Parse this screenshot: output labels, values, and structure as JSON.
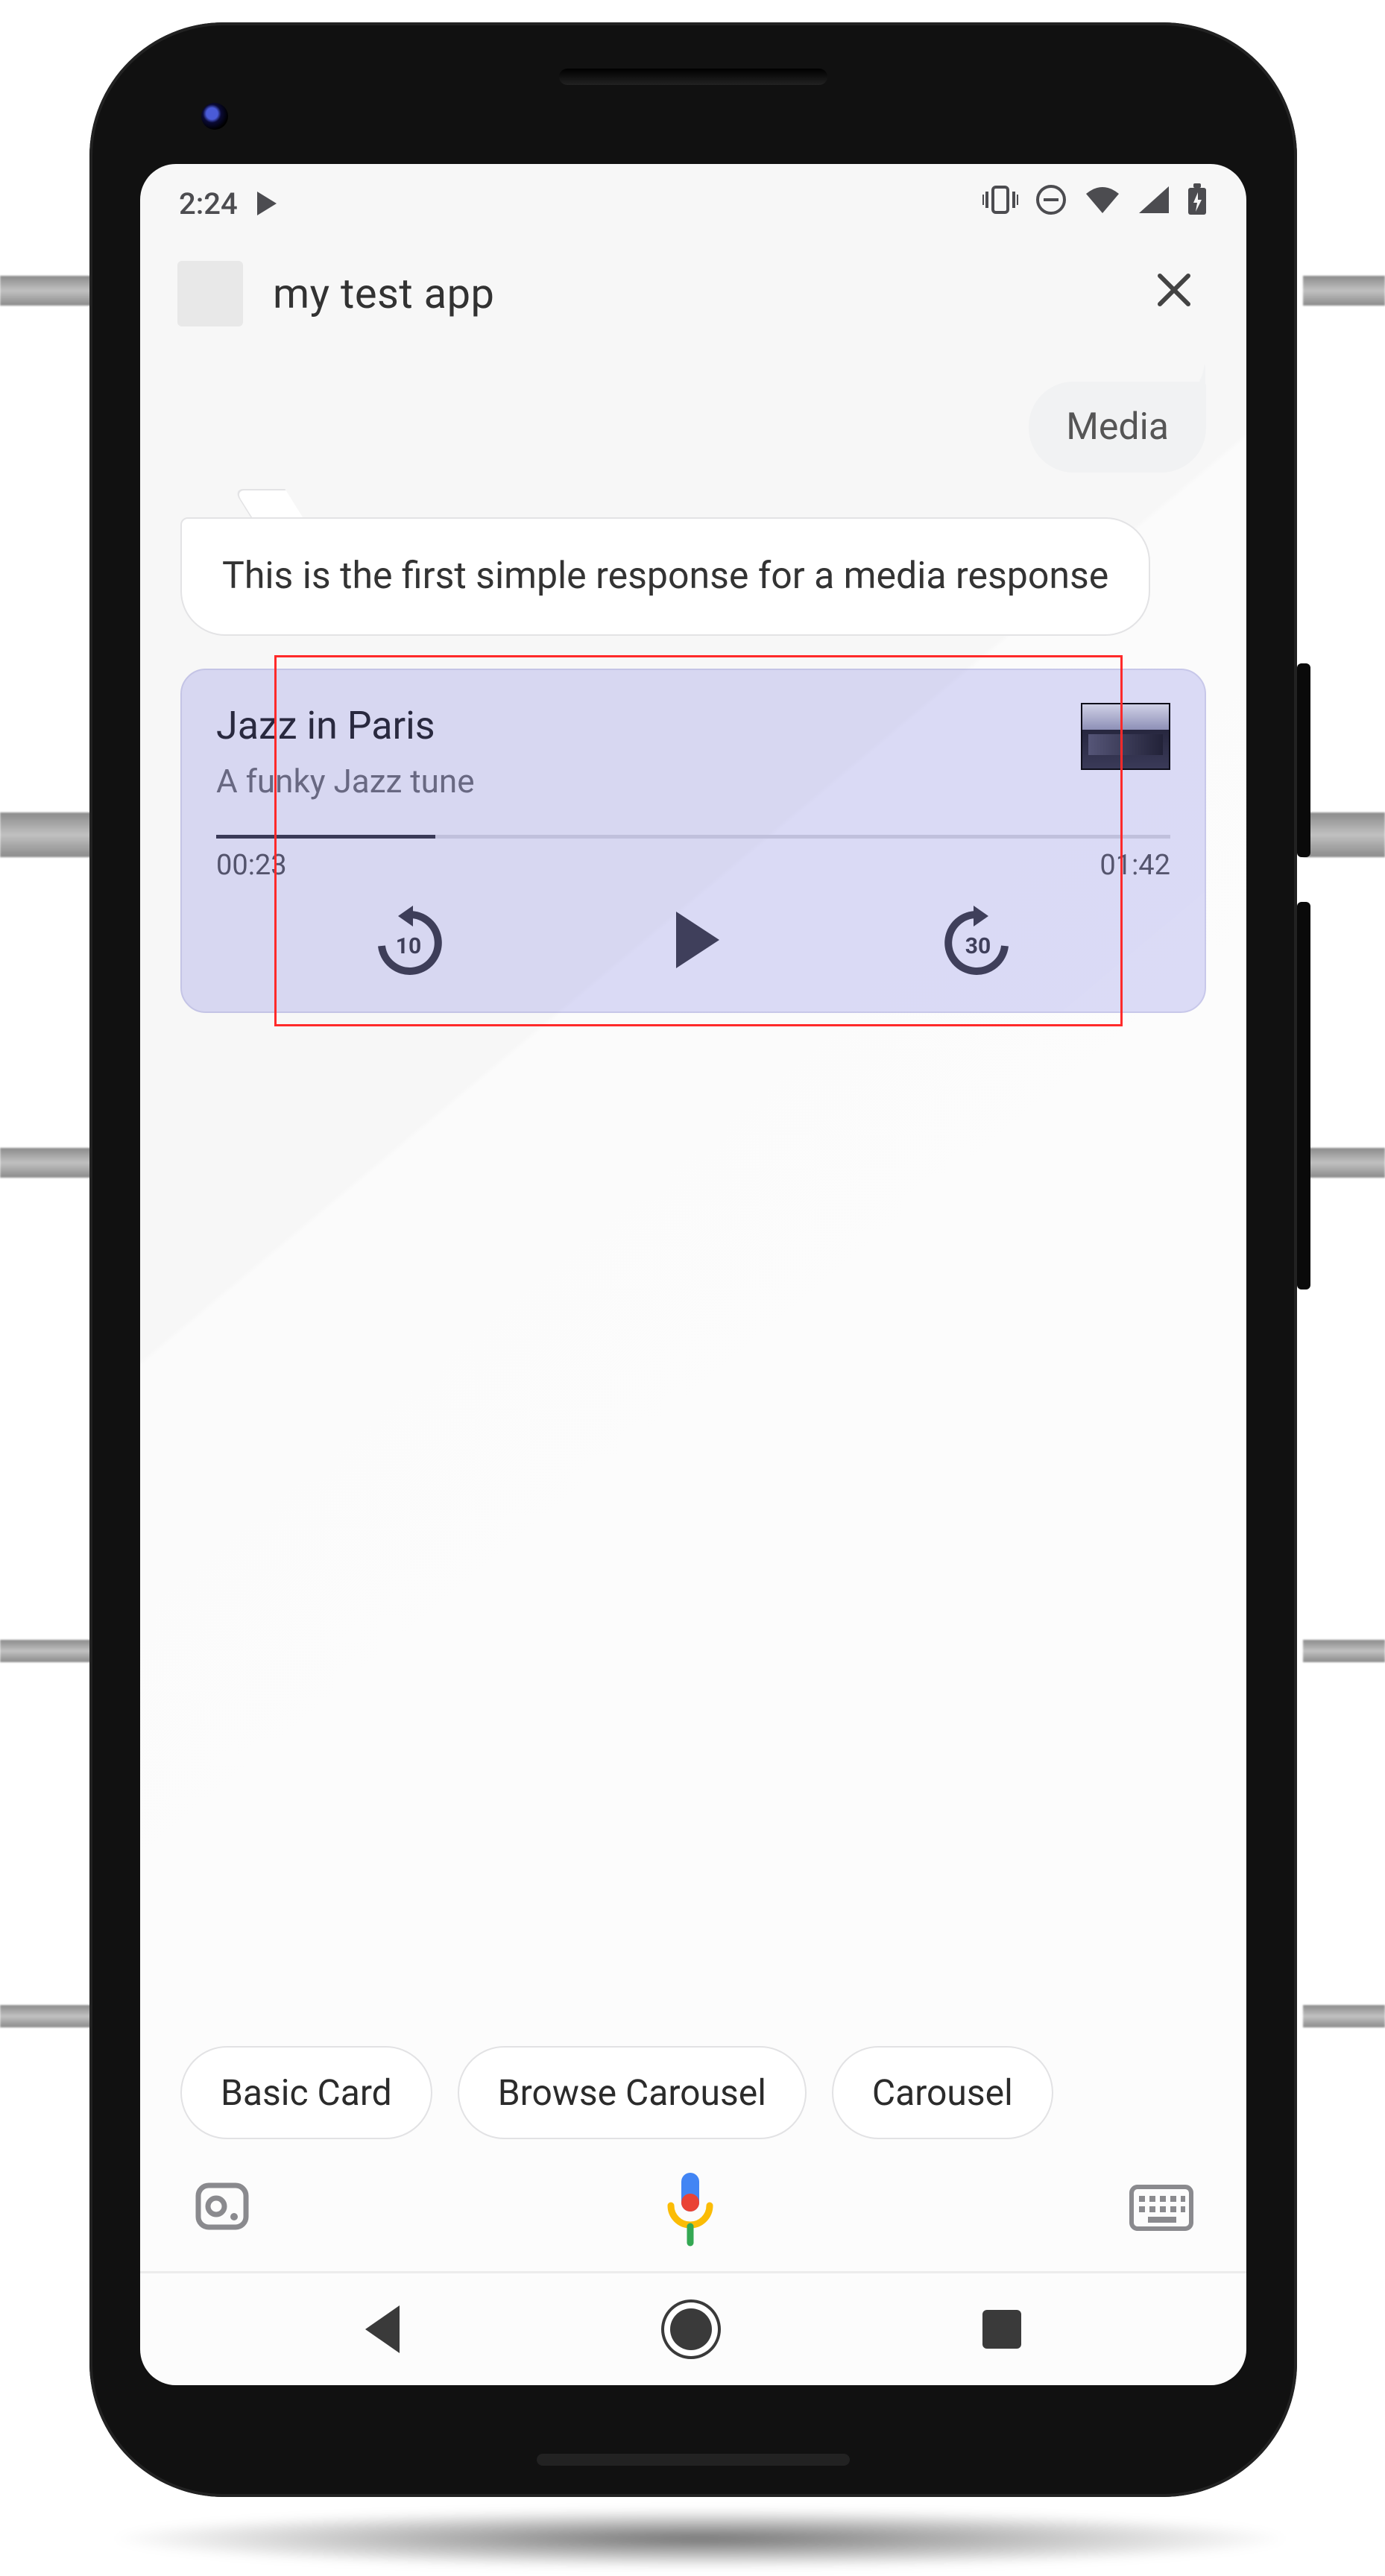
{
  "status": {
    "time": "2:24"
  },
  "header": {
    "app_name": "my test app"
  },
  "conversation": {
    "user_message": "Media",
    "bot_message": "This is the first simple response for a media response"
  },
  "media": {
    "title": "Jazz in Paris",
    "subtitle": "A funky Jazz tune",
    "elapsed": "00:23",
    "duration": "01:42",
    "progress_percent": 23,
    "rewind_seconds": "10",
    "forward_seconds": "30"
  },
  "chips": [
    "Basic Card",
    "Browse Carousel",
    "Carousel"
  ],
  "icons": {
    "playing": "play-icon",
    "vibrate": "vibrate-icon",
    "dnd": "do-not-disturb-icon",
    "wifi": "wifi-icon",
    "cell": "cell-signal-icon",
    "battery": "battery-charging-icon",
    "close": "close-icon",
    "rewind": "rewind-10-icon",
    "play": "play-icon",
    "forward": "forward-30-icon",
    "lens": "lens-icon",
    "mic": "mic-icon",
    "keyboard": "keyboard-icon",
    "nav_back": "nav-back-icon",
    "nav_home": "nav-home-icon",
    "nav_recent": "nav-recent-icon"
  }
}
